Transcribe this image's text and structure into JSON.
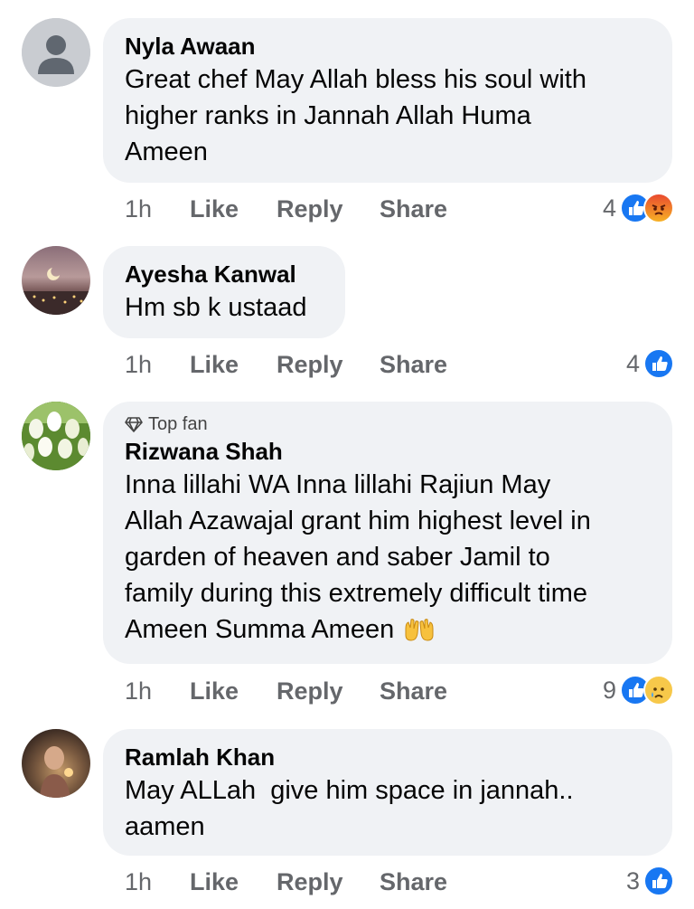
{
  "comments": [
    {
      "author": "Nyla Awaan",
      "text_lines": [
        "Great chef May Allah bless his soul with",
        "higher ranks in Jannah Allah Huma",
        "Ameen"
      ],
      "time": "1h",
      "reaction_count": "4",
      "reactions": [
        "like-icon",
        "angry-icon"
      ]
    },
    {
      "author": "Ayesha Kanwal",
      "text_lines": [
        "Hm sb k ustaad"
      ],
      "time": "1h",
      "reaction_count": "4",
      "reactions": [
        "like-icon"
      ]
    },
    {
      "badge": "Top fan",
      "author": "Rizwana Shah",
      "text_lines": [
        "Inna lillahi WA Inna lillahi Rajiun May",
        "Allah Azawajal grant him highest level in",
        "garden of heaven and saber Jamil to",
        "family during this extremely difficult time",
        "Ameen Summa Ameen"
      ],
      "time": "1h",
      "reaction_count": "9",
      "reactions": [
        "like-icon",
        "sad-icon"
      ]
    },
    {
      "author": "Ramlah Khan",
      "text_lines": [
        "May ALLah  give him space in jannah..",
        "aamen"
      ],
      "time": "1h",
      "reaction_count": "3",
      "reactions": [
        "like-icon"
      ]
    }
  ],
  "actions": {
    "like": "Like",
    "reply": "Reply",
    "share": "Share"
  },
  "colors": {
    "bubble": "#f0f2f5",
    "meta": "#65676b",
    "like": "#1877f2"
  }
}
